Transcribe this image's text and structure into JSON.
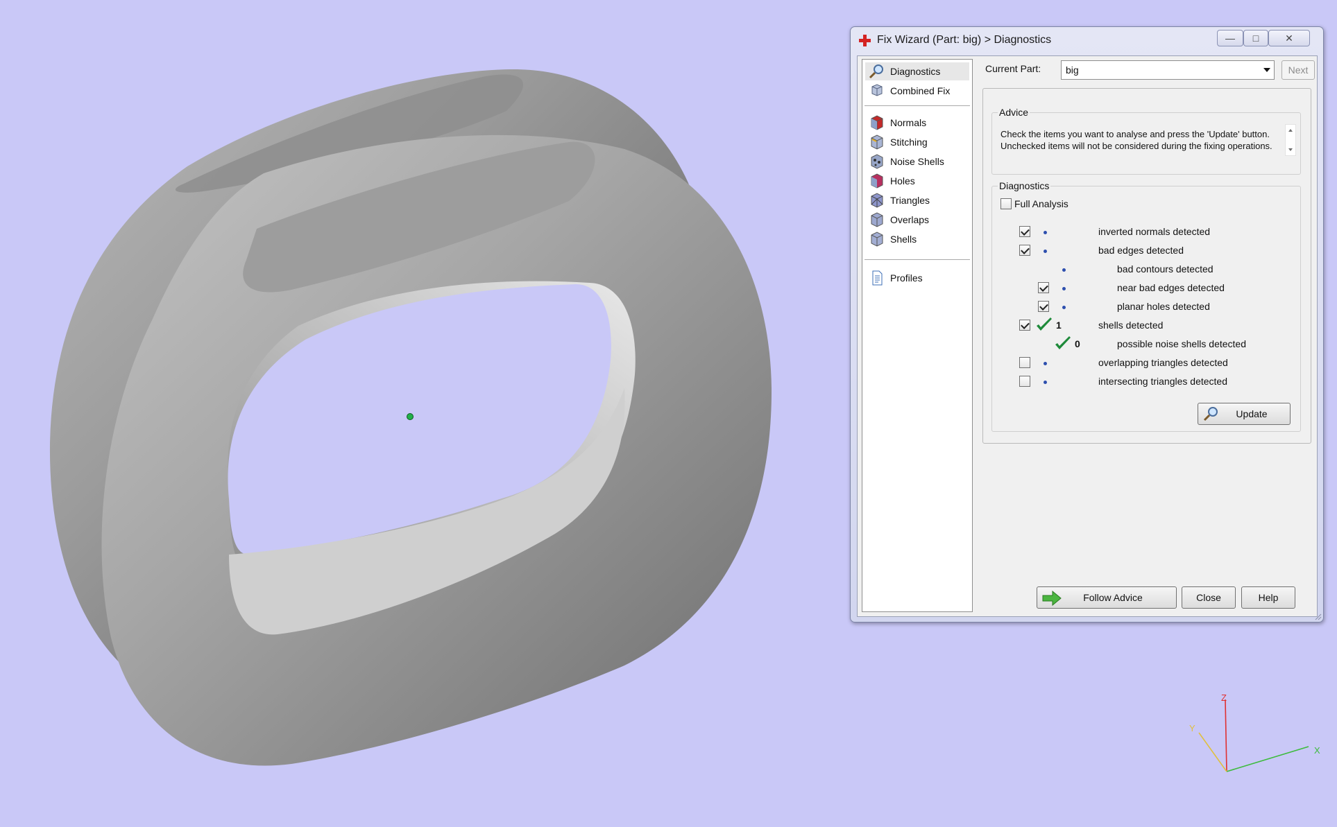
{
  "window": {
    "title": "Fix Wizard (Part: big) > Diagnostics",
    "controls": {
      "minimize": "—",
      "maximize": "□",
      "close": "✕"
    }
  },
  "nav": {
    "items": [
      {
        "label": "Diagnostics",
        "icon": "magnifier-icon",
        "selected": true
      },
      {
        "label": "Combined Fix",
        "icon": "cube-stack-icon"
      },
      {
        "label": "Normals",
        "icon": "normals-cube-icon"
      },
      {
        "label": "Stitching",
        "icon": "stitching-cube-icon"
      },
      {
        "label": "Noise Shells",
        "icon": "noise-shells-icon"
      },
      {
        "label": "Holes",
        "icon": "holes-cube-icon"
      },
      {
        "label": "Triangles",
        "icon": "triangles-cube-icon"
      },
      {
        "label": "Overlaps",
        "icon": "overlaps-cube-icon"
      },
      {
        "label": "Shells",
        "icon": "shells-cube-icon"
      },
      {
        "label": "Profiles",
        "icon": "document-icon"
      }
    ]
  },
  "current_part": {
    "label": "Current Part:",
    "value": "big",
    "next_label": "Next"
  },
  "advice": {
    "title": "Advice",
    "text": "Check the items you want to analyse and press the 'Update' button. Unchecked items will not be considered during the fixing operations."
  },
  "diagnostics": {
    "title": "Diagnostics",
    "full_analysis_label": "Full Analysis",
    "full_analysis_checked": false,
    "rows": [
      {
        "label": "inverted normals detected",
        "checked": true,
        "has_checkbox": true,
        "status": "dot",
        "indent": false
      },
      {
        "label": "bad edges detected",
        "checked": true,
        "has_checkbox": true,
        "status": "dot",
        "indent": false
      },
      {
        "label": "bad contours detected",
        "checked": false,
        "has_checkbox": false,
        "status": "dot",
        "indent": true
      },
      {
        "label": "near bad edges detected",
        "checked": true,
        "has_checkbox": true,
        "status": "dot",
        "indent": true
      },
      {
        "label": "planar holes detected",
        "checked": true,
        "has_checkbox": true,
        "status": "dot",
        "indent": true
      },
      {
        "label": "shells detected",
        "checked": true,
        "has_checkbox": true,
        "status": "ok",
        "count": "1",
        "indent": false
      },
      {
        "label": "possible noise shells detected",
        "checked": false,
        "has_checkbox": false,
        "status": "ok",
        "count": "0",
        "indent": true
      },
      {
        "label": "overlapping triangles detected",
        "checked": false,
        "has_checkbox": true,
        "status": "dot",
        "indent": false
      },
      {
        "label": "intersecting triangles detected",
        "checked": false,
        "has_checkbox": true,
        "status": "dot",
        "indent": false
      }
    ],
    "update_label": "Update"
  },
  "footer": {
    "follow_advice_label": "Follow Advice",
    "close_label": "Close",
    "help_label": "Help"
  },
  "axes": {
    "x": "X",
    "y": "Y",
    "z": "Z"
  },
  "colors": {
    "background": "#c9c8f7",
    "model": "#9a9a9a",
    "ok_check": "#1e8a3a",
    "status_dot": "#2d4fae",
    "axis_x": "#3cbb3c",
    "axis_y": "#e0c040",
    "axis_z": "#e03030"
  }
}
